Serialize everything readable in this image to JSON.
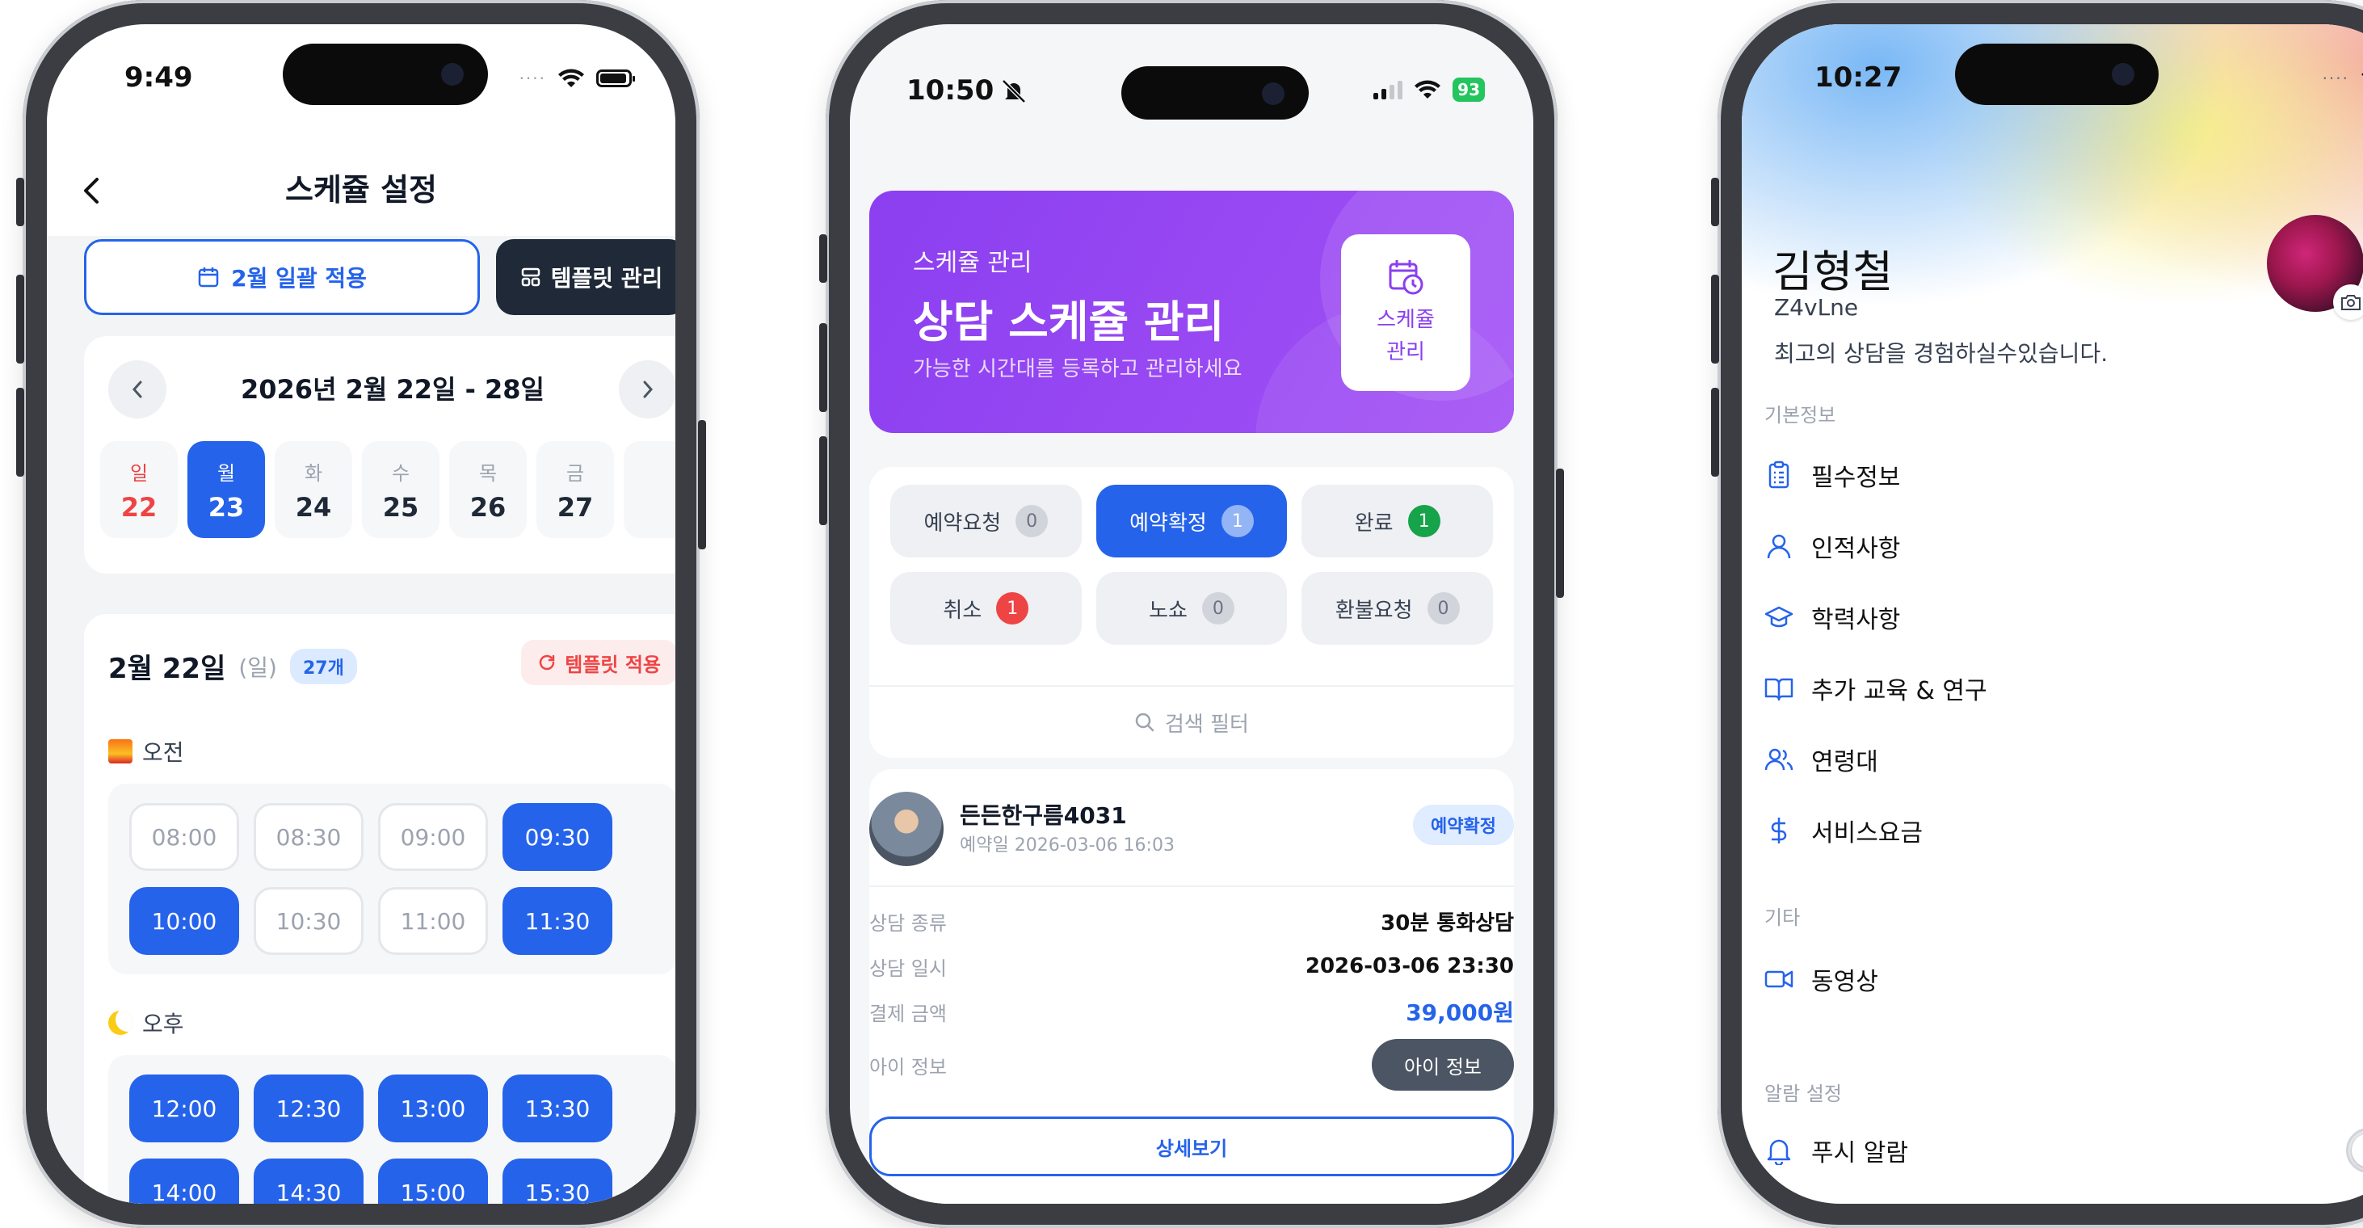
{
  "phone1": {
    "status_time": "9:49",
    "header_title": "스케쥴 설정",
    "apply_month_label": "2월 일괄 적용",
    "template_manage_label": "템플릿 관리",
    "week_range": "2026년 2월 22일 - 28일",
    "days": [
      {
        "weekday": "일",
        "date": "22"
      },
      {
        "weekday": "월",
        "date": "23"
      },
      {
        "weekday": "화",
        "date": "24"
      },
      {
        "weekday": "수",
        "date": "25"
      },
      {
        "weekday": "목",
        "date": "26"
      },
      {
        "weekday": "금",
        "date": "27"
      }
    ],
    "selected_date": "2월 22일",
    "selected_weekday": "(일)",
    "slot_count": "27개",
    "apply_template_label": "템플릿 적용",
    "morning_label": "오전",
    "afternoon_label": "오후",
    "morning_slots": [
      {
        "time": "08:00",
        "active": false
      },
      {
        "time": "08:30",
        "active": false
      },
      {
        "time": "09:00",
        "active": false
      },
      {
        "time": "09:30",
        "active": true
      },
      {
        "time": "10:00",
        "active": true
      },
      {
        "time": "10:30",
        "active": false
      },
      {
        "time": "11:00",
        "active": false
      },
      {
        "time": "11:30",
        "active": true
      }
    ],
    "afternoon_slots": [
      {
        "time": "12:00",
        "active": true
      },
      {
        "time": "12:30",
        "active": true
      },
      {
        "time": "13:00",
        "active": true
      },
      {
        "time": "13:30",
        "active": true
      },
      {
        "time": "14:00",
        "active": true
      },
      {
        "time": "14:30",
        "active": true
      },
      {
        "time": "15:00",
        "active": true
      },
      {
        "time": "15:30",
        "active": true
      }
    ]
  },
  "phone2": {
    "status_time": "10:50",
    "battery": "93",
    "banner_sub": "스케쥴 관리",
    "banner_title": "상담 스케쥴 관리",
    "banner_desc": "가능한 시간대를 등록하고 관리하세요",
    "banner_tile_line1": "스케쥴",
    "banner_tile_line2": "관리",
    "statuses": [
      {
        "label": "예약요청",
        "count": "0"
      },
      {
        "label": "예약확정",
        "count": "1"
      },
      {
        "label": "완료",
        "count": "1"
      },
      {
        "label": "취소",
        "count": "1"
      },
      {
        "label": "노쇼",
        "count": "0"
      },
      {
        "label": "환불요청",
        "count": "0"
      }
    ],
    "search_filter_label": "검색 필터",
    "reservation": {
      "name": "든든한구름4031",
      "date_line": "예약일 2026-03-06 16:03",
      "badge": "예약확정",
      "type_key": "상담 종류",
      "type_value": "30분 통화상담",
      "datetime_key": "상담 일시",
      "datetime_value": "2026-03-06 23:30",
      "amount_key": "결제 금액",
      "amount_value": "39,000원",
      "child_key": "아이 정보",
      "child_button": "아이 정보",
      "detail_button": "상세보기"
    }
  },
  "phone3": {
    "status_time": "10:27",
    "name": "김형철",
    "user_id": "Z4vLne",
    "bio": "최고의 상담을 경험하실수있습니다.",
    "section_basic": "기본정보",
    "section_other": "기타",
    "section_alarm": "알람 설정",
    "menu_basic": [
      {
        "label": "필수정보",
        "icon": "clipboard-icon"
      },
      {
        "label": "인적사항",
        "icon": "user-icon"
      },
      {
        "label": "학력사항",
        "icon": "graduation-cap-icon"
      },
      {
        "label": "추가 교육 & 연구",
        "icon": "book-icon"
      },
      {
        "label": "연령대",
        "icon": "users-icon"
      },
      {
        "label": "서비스요금",
        "icon": "dollar-icon"
      }
    ],
    "menu_other": [
      {
        "label": "동영상",
        "icon": "video-icon"
      }
    ],
    "push_label": "푸시 알람",
    "push_enabled": false
  },
  "colors": {
    "accent": "#2563eb",
    "purple": "#8b3ff0",
    "dark": "#1f2937",
    "danger": "#ef4444",
    "success": "#16a34a"
  }
}
